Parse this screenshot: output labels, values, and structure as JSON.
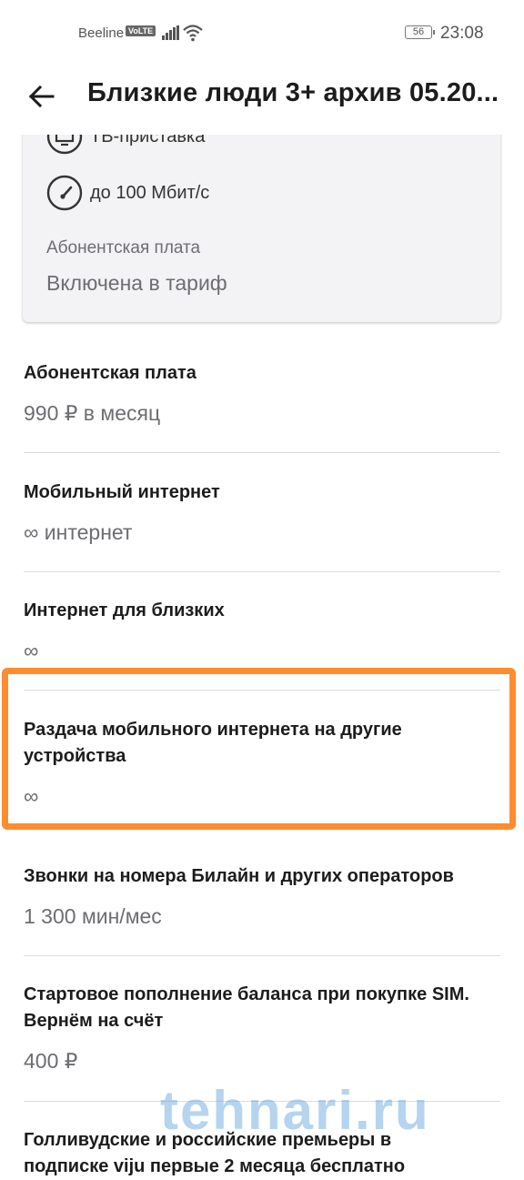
{
  "status_bar": {
    "carrier": "Beeline",
    "volte": "VoLTE",
    "battery": "56",
    "time": "23:08"
  },
  "header": {
    "title": "Близкие люди 3+ архив 05.20..."
  },
  "card": {
    "features": [
      {
        "icon": "tv-icon",
        "label": "ТВ-приставка"
      },
      {
        "icon": "speedometer-icon",
        "label": "до 100 Мбит/с"
      }
    ],
    "fee_label": "Абонентская плата",
    "fee_value": "Включена в тариф"
  },
  "sections": [
    {
      "title": "Абонентская плата",
      "value": "990 ₽ в месяц"
    },
    {
      "title": "Мобильный интернет",
      "value": "∞ интернет"
    },
    {
      "title": "Интернет для близких",
      "value": "∞"
    },
    {
      "title_line1": "Раздача мобильного интернета на другие",
      "title_line2": "устройства",
      "value": "∞"
    },
    {
      "title": "Звонки на номера Билайн и других операторов",
      "value": "1 300 мин/мес"
    },
    {
      "title_line1": "Стартовое пополнение баланса при покупке SIM.",
      "title_line2": "Вернём на счёт",
      "value": "400 ₽"
    },
    {
      "title_line1": "Голливудские и российские премьеры в",
      "title_line2": "подписке viju первые 2 месяца бесплатно"
    }
  ],
  "watermark": "tehnari.ru",
  "colors": {
    "highlight": "#ff8c2e",
    "card_bg": "#f3f3f5",
    "muted_text": "#6d6d72"
  }
}
